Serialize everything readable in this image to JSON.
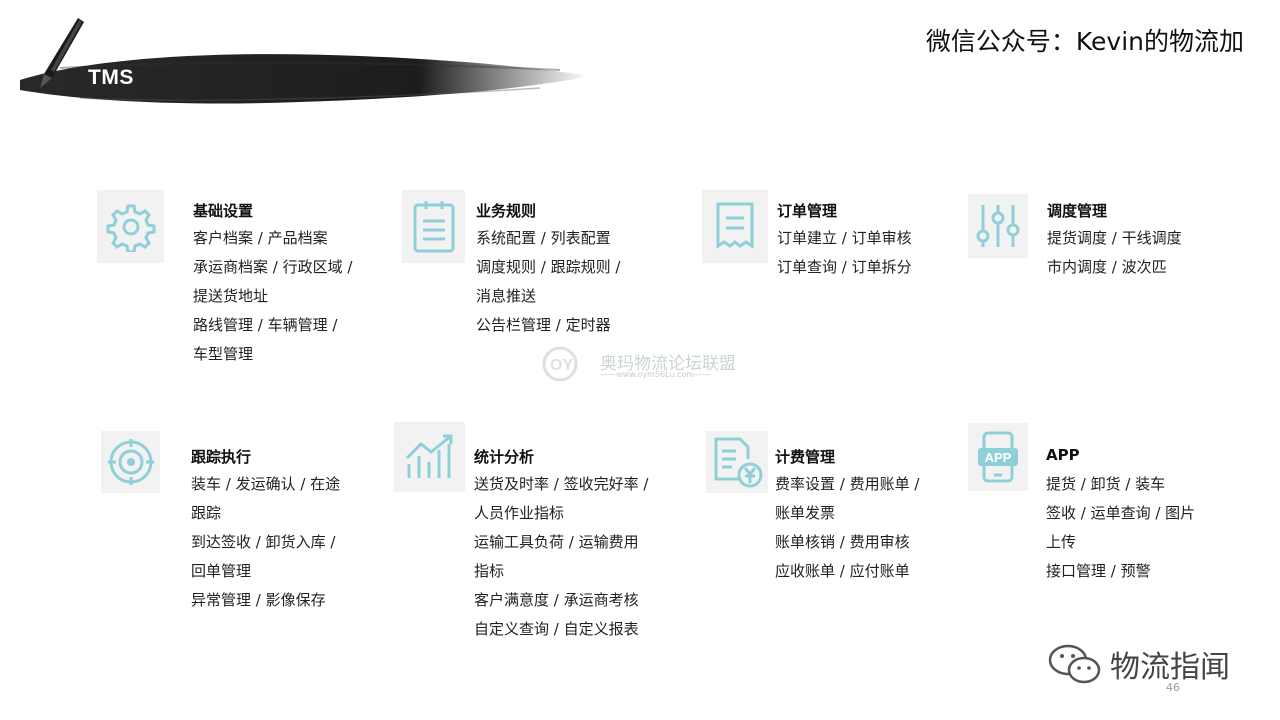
{
  "header": {
    "title": "TMS",
    "account": "微信公众号：Kevin的物流加"
  },
  "modules": [
    {
      "icon": "gear-icon",
      "title": "基础设置",
      "lines": [
        "客户档案 / 产品档案",
        "承运商档案 / 行政区域 /",
        "提送货地址",
        "路线管理 / 车辆管理 /",
        "车型管理"
      ]
    },
    {
      "icon": "document-list-icon",
      "title": "业务规则",
      "lines": [
        "系统配置 / 列表配置",
        "调度规则 / 跟踪规则 /",
        "消息推送",
        "公告栏管理 / 定时器"
      ]
    },
    {
      "icon": "receipt-icon",
      "title": "订单管理",
      "lines": [
        "订单建立 / 订单审核",
        "订单查询 / 订单拆分"
      ]
    },
    {
      "icon": "sliders-icon",
      "title": "调度管理",
      "lines": [
        "提货调度 / 干线调度",
        "市内调度 / 波次匹"
      ]
    },
    {
      "icon": "target-icon",
      "title": "跟踪执行",
      "lines": [
        "装车 / 发运确认 / 在途",
        "跟踪",
        "到达签收 / 卸货入库 /",
        "回单管理",
        "异常管理 / 影像保存"
      ]
    },
    {
      "icon": "bar-chart-icon",
      "title": "统计分析",
      "lines": [
        "送货及时率 / 签收完好率 /",
        "人员作业指标",
        "运输工具负荷 / 运输费用",
        "指标",
        "客户满意度 / 承运商考核",
        "自定义查询 / 自定义报表"
      ]
    },
    {
      "icon": "invoice-yuan-icon",
      "title": "计费管理",
      "lines": [
        "费率设置 / 费用账单 /",
        "账单发票",
        "账单核销 / 费用审核",
        "应收账单 / 应付账单"
      ]
    },
    {
      "icon": "mobile-app-icon",
      "title": "APP",
      "lines": [
        "提货 / 卸货 / 装车",
        "签收 / 运单查询 / 图片",
        "上传",
        "接口管理 / 预警"
      ]
    }
  ],
  "watermark": {
    "text": "奥玛物流论坛联盟",
    "sub": "——www.oym56Lu.com——"
  },
  "footer": {
    "brand": "物流指闻",
    "page_number": "46"
  },
  "colors": {
    "icon_accent": "#8fd0d8",
    "icon_bg": "#f2f2f2",
    "brush": "#111111"
  }
}
